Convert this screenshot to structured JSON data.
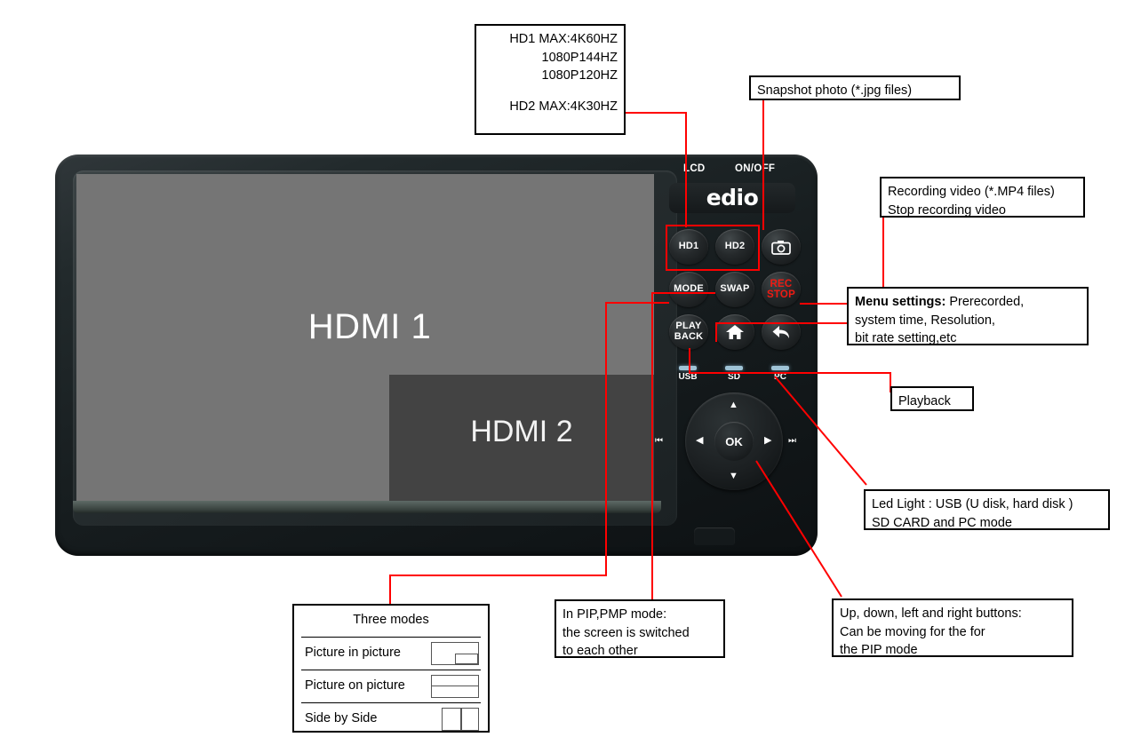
{
  "device": {
    "brand_logo": "edio",
    "top_labels": {
      "lcd": "LCD",
      "on_off": "ON/OFF"
    },
    "buttons": [
      {
        "name": "HD1",
        "label": "HD1"
      },
      {
        "name": "HD2",
        "label": "HD2"
      },
      {
        "name": "snapshot",
        "label": "camera-icon"
      },
      {
        "name": "MODE",
        "label": "MODE"
      },
      {
        "name": "SWAP",
        "label": "SWAP"
      },
      {
        "name": "REC/STOP",
        "label_line1": "REC",
        "label_line2": "STOP",
        "color": "#ee1b13"
      },
      {
        "name": "PLAYBACK",
        "label_line1": "PLAY",
        "label_line2": "BACK"
      },
      {
        "name": "HOME",
        "label": "home-icon"
      },
      {
        "name": "BACK",
        "label": "back-arrow-icon"
      }
    ],
    "leds": [
      {
        "label": "USB",
        "color": "#9fc3d6"
      },
      {
        "label": "SD",
        "color": "#9fc3d6"
      },
      {
        "label": "PC",
        "color": "#9fc3d6"
      }
    ],
    "dpad": {
      "ok": "OK",
      "up": "▲",
      "down": "▼",
      "left": "◀",
      "right": "▶",
      "prev_track": "⏮",
      "next_track": "⏭"
    },
    "screen": {
      "main_label": "HDMI 1",
      "main_color": "#757575",
      "pip_label": "HDMI 2",
      "pip_color": "#434343"
    }
  },
  "annotations": {
    "hd_resolutions": {
      "line1": "HD1 MAX:4K60HZ",
      "line2": "1080P144HZ",
      "line3": "1080P120HZ",
      "line4": "",
      "line5": "HD2 MAX:4K30HZ"
    },
    "snapshot": {
      "text": "Snapshot photo (*.jpg files)"
    },
    "recording": {
      "line1": "Recording video (*.MP4 files)",
      "line2": "Stop recording video"
    },
    "menu_settings": {
      "bold": "Menu settings:",
      "rest": " Prerecorded,",
      "line2": "system time, Resolution,",
      "line3": "bit rate setting,etc"
    },
    "playback": {
      "text": "Playback"
    },
    "led_light": {
      "line1": "Led Light : USB (U disk, hard disk )",
      "line2": "SD CARD and PC mode"
    },
    "dpad_note": {
      "line1": "Up, down, left and right buttons:",
      "line2": "Can be moving for the for",
      "line3": "the PIP mode"
    },
    "swap_note": {
      "line1": "In PIP,PMP mode:",
      "line2": "the screen is switched",
      "line3": "to each other"
    },
    "three_modes": {
      "title": "Three modes",
      "rows": [
        {
          "label": "Picture in picture",
          "icon": "pip-icon"
        },
        {
          "label": "Picture on picture",
          "icon": "pop-icon"
        },
        {
          "label": "Side by Side",
          "icon": "sbs-icon"
        }
      ]
    }
  },
  "colors": {
    "callout_line": "#ff0000",
    "callout_border": "#000000"
  }
}
